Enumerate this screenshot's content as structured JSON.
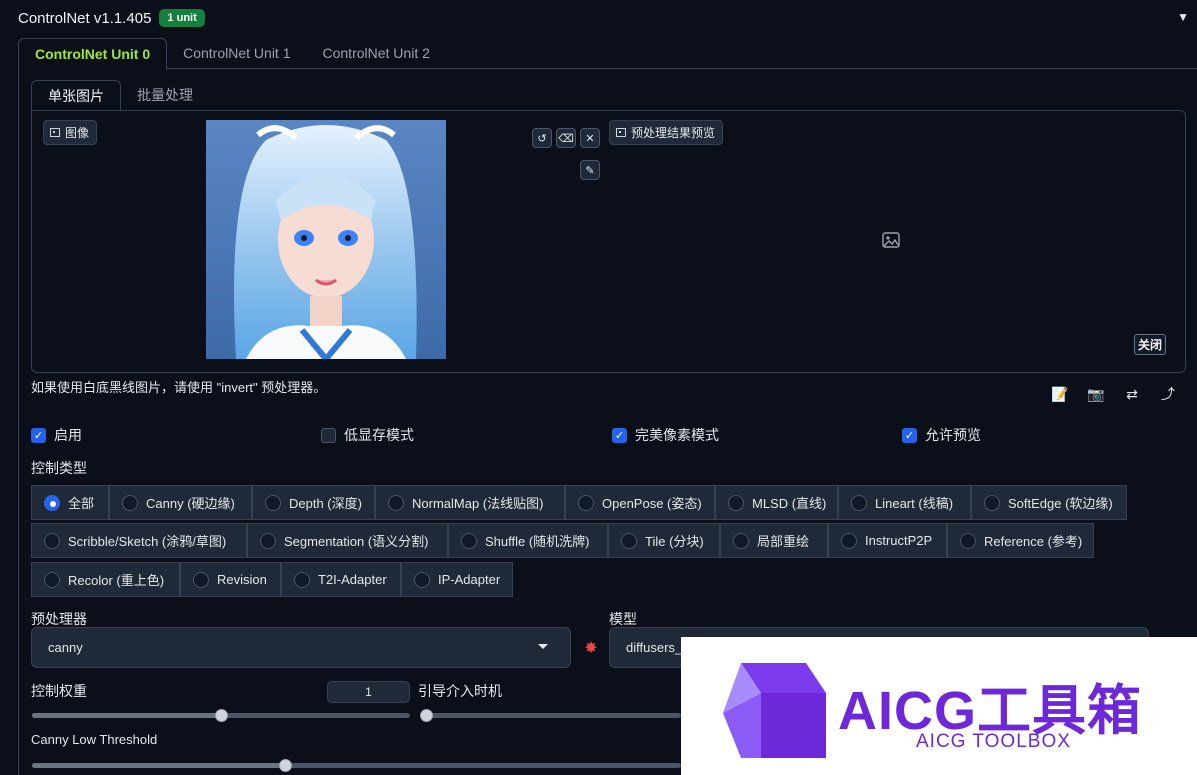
{
  "header": {
    "title": "ControlNet v1.1.405",
    "badge": "1 unit"
  },
  "unit_tabs": [
    "ControlNet Unit 0",
    "ControlNet Unit 1",
    "ControlNet Unit 2"
  ],
  "image_tabs": [
    "单张图片",
    "批量处理"
  ],
  "image_panel": {
    "input_label": "图像",
    "preview_label": "预处理结果预览",
    "close_label": "关闭"
  },
  "hint": "如果使用白底黑线图片，请使用 \"invert\" 预处理器。",
  "checkboxes": [
    {
      "label": "启用",
      "checked": true
    },
    {
      "label": "低显存模式",
      "checked": false
    },
    {
      "label": "完美像素模式",
      "checked": true
    },
    {
      "label": "允许预览",
      "checked": true
    }
  ],
  "control_type": {
    "label": "控制类型",
    "options": [
      {
        "label": "全部",
        "selected": true
      },
      {
        "label": "Canny (硬边缘)",
        "selected": false
      },
      {
        "label": "Depth (深度)",
        "selected": false
      },
      {
        "label": "NormalMap (法线贴图)",
        "selected": false
      },
      {
        "label": "OpenPose (姿态)",
        "selected": false
      },
      {
        "label": "MLSD (直线)",
        "selected": false
      },
      {
        "label": "Lineart (线稿)",
        "selected": false
      },
      {
        "label": "SoftEdge (软边缘)",
        "selected": false
      },
      {
        "label": "Scribble/Sketch (涂鸦/草图)",
        "selected": false
      },
      {
        "label": "Segmentation (语义分割)",
        "selected": false
      },
      {
        "label": "Shuffle (随机洗牌)",
        "selected": false
      },
      {
        "label": "Tile (分块)",
        "selected": false
      },
      {
        "label": "局部重绘",
        "selected": false
      },
      {
        "label": "InstructP2P",
        "selected": false
      },
      {
        "label": "Reference (参考)",
        "selected": false
      },
      {
        "label": "Recolor (重上色)",
        "selected": false
      },
      {
        "label": "Revision",
        "selected": false
      },
      {
        "label": "T2I-Adapter",
        "selected": false
      },
      {
        "label": "IP-Adapter",
        "selected": false
      }
    ]
  },
  "preprocessor": {
    "label": "预处理器",
    "value": "canny"
  },
  "model": {
    "label": "模型",
    "value": "diffusers_"
  },
  "weight": {
    "label": "控制权重",
    "value": "1",
    "fraction": 0.5
  },
  "guidance_start": {
    "label": "引导介入时机",
    "fraction": 0.0
  },
  "canny_low": {
    "label": "Canny Low Threshold",
    "fraction": 0.39
  },
  "watermark": {
    "title": "AICG工具箱",
    "subtitle": "AICG TOOLBOX"
  },
  "colors": {
    "accent": "#2563eb",
    "active_tab": "#a3e635",
    "badge": "#15803d",
    "watermark": "#6d28d9"
  }
}
